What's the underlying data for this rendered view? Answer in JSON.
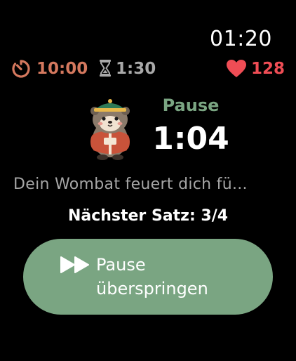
{
  "status": {
    "clock": "01:20"
  },
  "stats": {
    "timer": {
      "icon": "timer-icon",
      "value": "10:00",
      "color": "#d4785e"
    },
    "rest": {
      "icon": "hourglass-icon",
      "value": "1:30",
      "color": "#a9a9a9"
    },
    "heart_rate": {
      "icon": "heart-icon",
      "value": "128",
      "color": "#ef4d55"
    }
  },
  "rest_panel": {
    "mascot": "wombat-mascot",
    "label": "Pause",
    "countdown": "1:04",
    "label_color": "#7aa582"
  },
  "message": "Dein Wombat feuert dich fü...",
  "next_set": "Nächster Satz: 3/4",
  "skip_button": {
    "icon": "fast-forward-icon",
    "line1": "Pause",
    "line2": "überspringen",
    "color": "#7aa582"
  }
}
